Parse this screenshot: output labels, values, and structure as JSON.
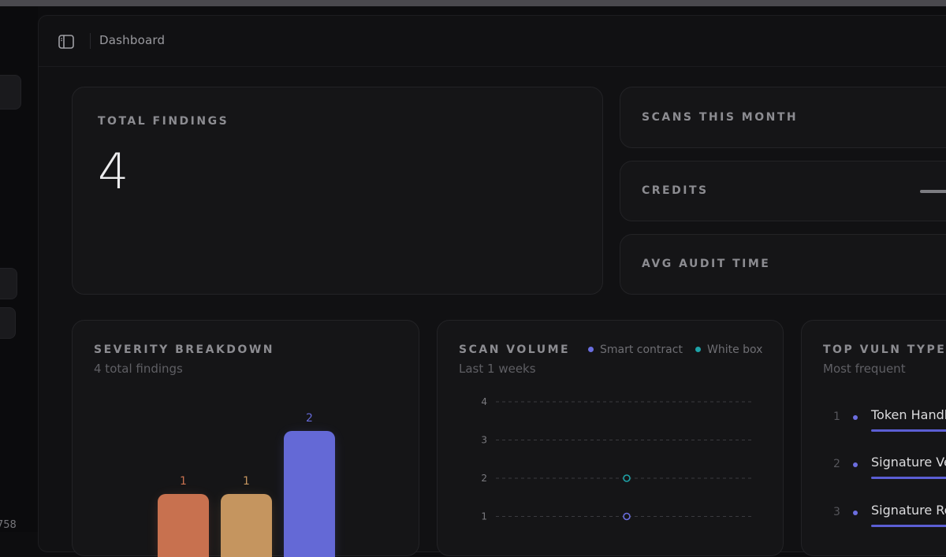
{
  "header": {
    "title": "Dashboard"
  },
  "left_rail": {
    "footer_text": "758"
  },
  "stats": {
    "total_findings": {
      "label": "TOTAL FINDINGS",
      "value": "4"
    },
    "scans_this_month": {
      "label": "SCANS THIS MONTH"
    },
    "credits": {
      "label": "CREDITS"
    },
    "avg_audit_time": {
      "label": "AVG AUDIT TIME"
    }
  },
  "severity": {
    "title": "SEVERITY BREAKDOWN",
    "subtitle": "4 total findings",
    "colors": [
      "#c8714f",
      "#c5955f",
      "#6469d6"
    ]
  },
  "scan_volume": {
    "title": "SCAN VOLUME",
    "subtitle": "Last 1 weeks",
    "legend": [
      {
        "name": "Smart contract",
        "color": "#6a6ee0"
      },
      {
        "name": "White box",
        "color": "#1ea3a8"
      }
    ]
  },
  "top_vulns": {
    "title": "TOP VULN TYPES",
    "subtitle": "Most frequent",
    "items": [
      {
        "rank": "1",
        "name": "Token Handling"
      },
      {
        "rank": "2",
        "name": "Signature Verification"
      },
      {
        "rank": "3",
        "name": "Signature Replay"
      }
    ]
  },
  "chart_data": [
    {
      "type": "bar",
      "title": "SEVERITY BREAKDOWN",
      "categories": [
        "",
        "",
        ""
      ],
      "values": [
        1,
        1,
        2
      ],
      "ylim": [
        0,
        2
      ],
      "grid": false
    },
    {
      "type": "scatter",
      "title": "SCAN VOLUME",
      "ylim": [
        0,
        4
      ],
      "yticks": [
        "1",
        "2",
        "3",
        "4"
      ],
      "grid": true,
      "series": [
        {
          "name": "Smart contract",
          "values": [
            1
          ]
        },
        {
          "name": "White box",
          "values": [
            2
          ]
        }
      ]
    }
  ]
}
